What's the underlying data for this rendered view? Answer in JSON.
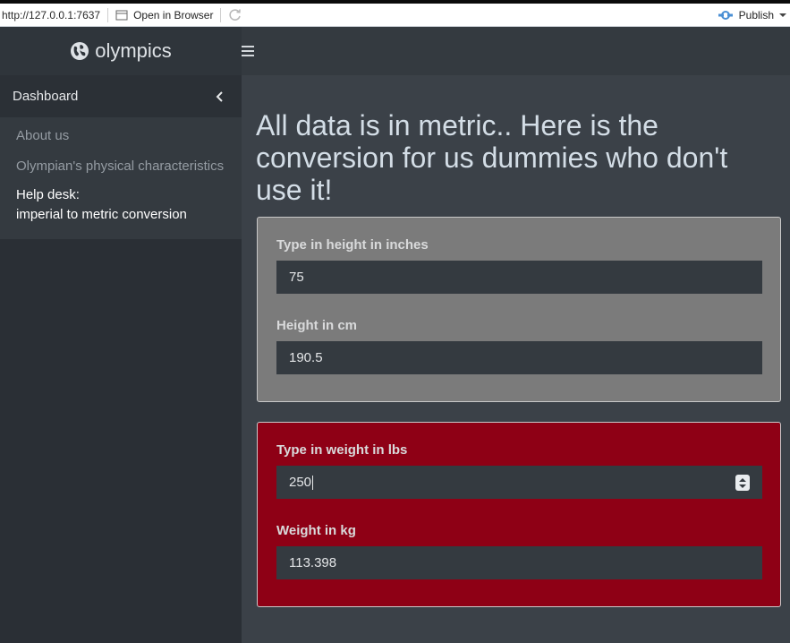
{
  "browser_bar": {
    "url": "http://127.0.0.1:7637",
    "open_in_browser": "Open in Browser",
    "publish": "Publish"
  },
  "header": {
    "brand": "olympics"
  },
  "sidebar": {
    "dashboard": "Dashboard",
    "items": [
      {
        "label": "About us"
      },
      {
        "label": "Olympian's physical characteristics"
      },
      {
        "label_line1": "Help desk:",
        "label_line2": "imperial to metric conversion"
      }
    ]
  },
  "main": {
    "title": "All data is in metric.. Here is the conversion for us dummies who don't use it!",
    "height_box": {
      "input_label": "Type in height in inches",
      "input_value": "75",
      "output_label": "Height in cm",
      "output_value": "190.5"
    },
    "weight_box": {
      "input_label": "Type in weight in lbs",
      "input_value": "250",
      "output_label": "Weight in kg",
      "output_value": "113.398"
    }
  },
  "colors": {
    "header_bg": "#343a40",
    "sidebar_bg": "#2a2f35",
    "content_bg": "#3b4148",
    "gray_box": "#7b7b7b",
    "red_box": "#8e0015"
  }
}
